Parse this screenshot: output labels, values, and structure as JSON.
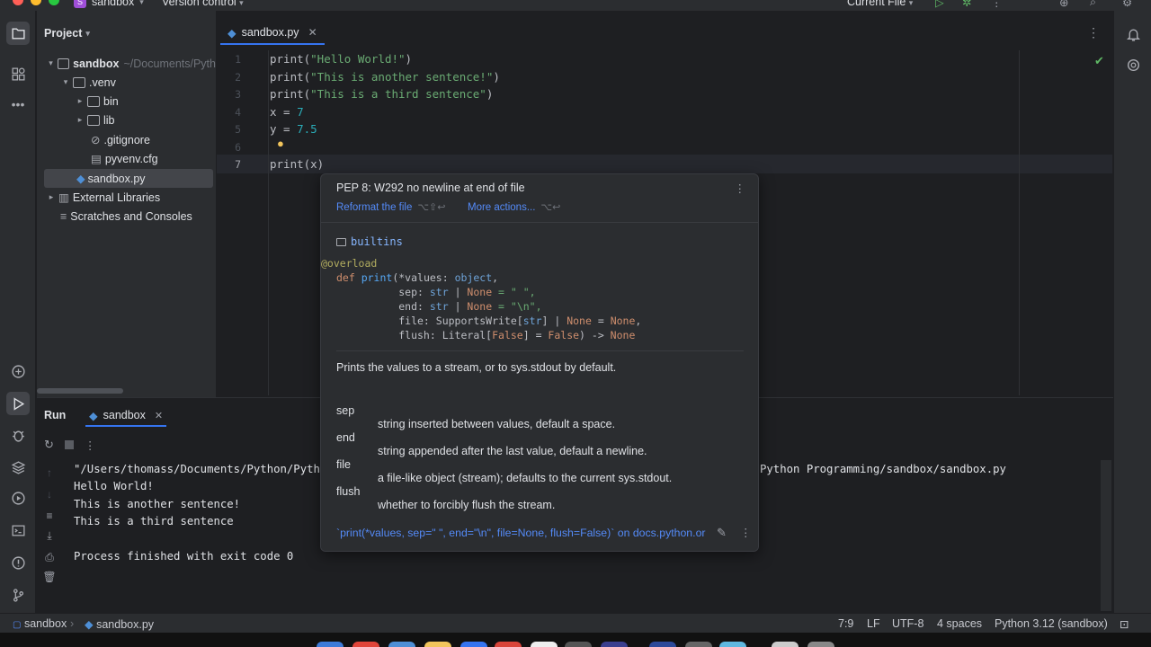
{
  "titlebar": {
    "project_badge": "S",
    "project_name": "sandbox",
    "vcs_label": "Version control",
    "run_config": "Current File"
  },
  "project_panel": {
    "header": "Project",
    "tree": [
      {
        "label": "sandbox",
        "path": "~/Documents/Pyth"
      },
      {
        "label": ".venv"
      },
      {
        "label": "bin"
      },
      {
        "label": "lib"
      },
      {
        "label": ".gitignore"
      },
      {
        "label": "pyvenv.cfg"
      },
      {
        "label": "sandbox.py"
      },
      {
        "label": "External Libraries"
      },
      {
        "label": "Scratches and Consoles"
      }
    ]
  },
  "editor": {
    "tab_label": "sandbox.py",
    "line_numbers": [
      "1",
      "2",
      "3",
      "4",
      "5",
      "6",
      "7"
    ],
    "lines": {
      "l1_fn": "print(",
      "l1_str": "\"Hello World!\"",
      "l1_end": ")",
      "l2_fn": "print(",
      "l2_str": "\"This is another sentence!\"",
      "l2_end": ")",
      "l3_fn": "print(",
      "l3_str": "\"This is a third sentence\"",
      "l3_end": ")",
      "l4_var": "x = ",
      "l4_num": "7",
      "l5_var": "y = ",
      "l5_num": "7.5",
      "l7_code": "print(x)"
    }
  },
  "popup": {
    "warning": "PEP 8: W292 no newline at end of file",
    "action1": "Reformat the file",
    "action1_key": "⌥⇧↩",
    "action2": "More actions...",
    "action2_key": "⌥↩",
    "module": "builtins",
    "sig": {
      "decorator": "@overload",
      "def_kw": "def ",
      "def_name": "print",
      "def_params": "(*values: ",
      "def_type": "object",
      "def_end": ",",
      "sep_label": "          sep: ",
      "sep_type": "str",
      "sep_rest": " | ",
      "sep_none": "None",
      "sep_val": " = \" \",",
      "end_label": "          end: ",
      "end_type": "str",
      "end_rest": " | ",
      "end_none": "None",
      "end_val": " = \"\\n\",",
      "file_label": "          file: SupportsWrite[",
      "file_type": "str",
      "file_rest": "] | ",
      "file_none": "None",
      "file_eq": " = ",
      "file_val": "None",
      "file_end": ",",
      "flush_label": "          flush: Literal[",
      "flush_false": "False",
      "flush_rest": "] = ",
      "flush_val": "False",
      "flush_arrow": ") -> ",
      "flush_ret": "None"
    },
    "description": "Prints the values to a stream, or to sys.stdout by default.",
    "params": [
      {
        "name": "sep",
        "desc": "string inserted between values, default a space."
      },
      {
        "name": "end",
        "desc": "string appended after the last value, default a newline."
      },
      {
        "name": "file",
        "desc": "a file-like object (stream); defaults to the current sys.stdout."
      },
      {
        "name": "flush",
        "desc": "whether to forcibly flush the stream."
      }
    ],
    "footer": "`print(*values, sep=\" \", end=\"\\n\", file=None, flush=False)` on docs.python.or"
  },
  "run_panel": {
    "title": "Run",
    "tab_label": "sandbox",
    "output": [
      "\"/Users/thomass/Documents/Python/Python",
      "Hello World!",
      "This is another sentence!",
      "This is a third sentence",
      "",
      "Process finished with exit code 0"
    ],
    "output_tail": "Python Programming/sandbox/sandbox.py"
  },
  "statusbar": {
    "project": "sandbox",
    "file": "sandbox.py",
    "position": "7:9",
    "line_sep": "LF",
    "encoding": "UTF-8",
    "indent": "4 spaces",
    "interpreter": "Python 3.12 (sandbox)"
  },
  "colors": {
    "accent": "#3574f0",
    "string": "#6aab73",
    "number": "#2aacb8",
    "keyword": "#cf8e6d",
    "link": "#548af7"
  }
}
